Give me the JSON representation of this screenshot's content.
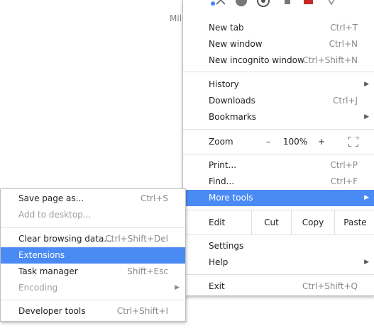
{
  "background": {
    "partial_text": "Mil"
  },
  "extension_icons": [
    "blue-dot-icon",
    "pin-icon",
    "info-icon",
    "globe-icon",
    "file-icon",
    "book-icon",
    "shield-icon"
  ],
  "menu": {
    "new_tab": {
      "label": "New tab",
      "accel": "Ctrl+T"
    },
    "new_window": {
      "label": "New window",
      "accel": "Ctrl+N"
    },
    "new_incognito": {
      "label": "New incognito window",
      "accel": "Ctrl+Shift+N"
    },
    "history": {
      "label": "History"
    },
    "downloads": {
      "label": "Downloads",
      "accel": "Ctrl+J"
    },
    "bookmarks": {
      "label": "Bookmarks"
    },
    "zoom": {
      "label": "Zoom",
      "minus": "–",
      "value": "100%",
      "plus": "+"
    },
    "print": {
      "label": "Print...",
      "accel": "Ctrl+P"
    },
    "find": {
      "label": "Find...",
      "accel": "Ctrl+F"
    },
    "more_tools": {
      "label": "More tools"
    },
    "edit": {
      "label": "Edit",
      "cut": "Cut",
      "copy": "Copy",
      "paste": "Paste"
    },
    "settings": {
      "label": "Settings"
    },
    "help": {
      "label": "Help"
    },
    "exit": {
      "label": "Exit",
      "accel": "Ctrl+Shift+Q"
    }
  },
  "submenu": {
    "save_page": {
      "label": "Save page as...",
      "accel": "Ctrl+S"
    },
    "add_desktop": {
      "label": "Add to desktop..."
    },
    "clear_data": {
      "label": "Clear browsing data...",
      "accel": "Ctrl+Shift+Del"
    },
    "extensions": {
      "label": "Extensions"
    },
    "task_manager": {
      "label": "Task manager",
      "accel": "Shift+Esc"
    },
    "encoding": {
      "label": "Encoding"
    },
    "developer_tools": {
      "label": "Developer tools",
      "accel": "Ctrl+Shift+I"
    }
  },
  "colors": {
    "highlight": "#4a8af4",
    "separator": "#e0e0e0",
    "accel_text": "#8a8a8a"
  }
}
